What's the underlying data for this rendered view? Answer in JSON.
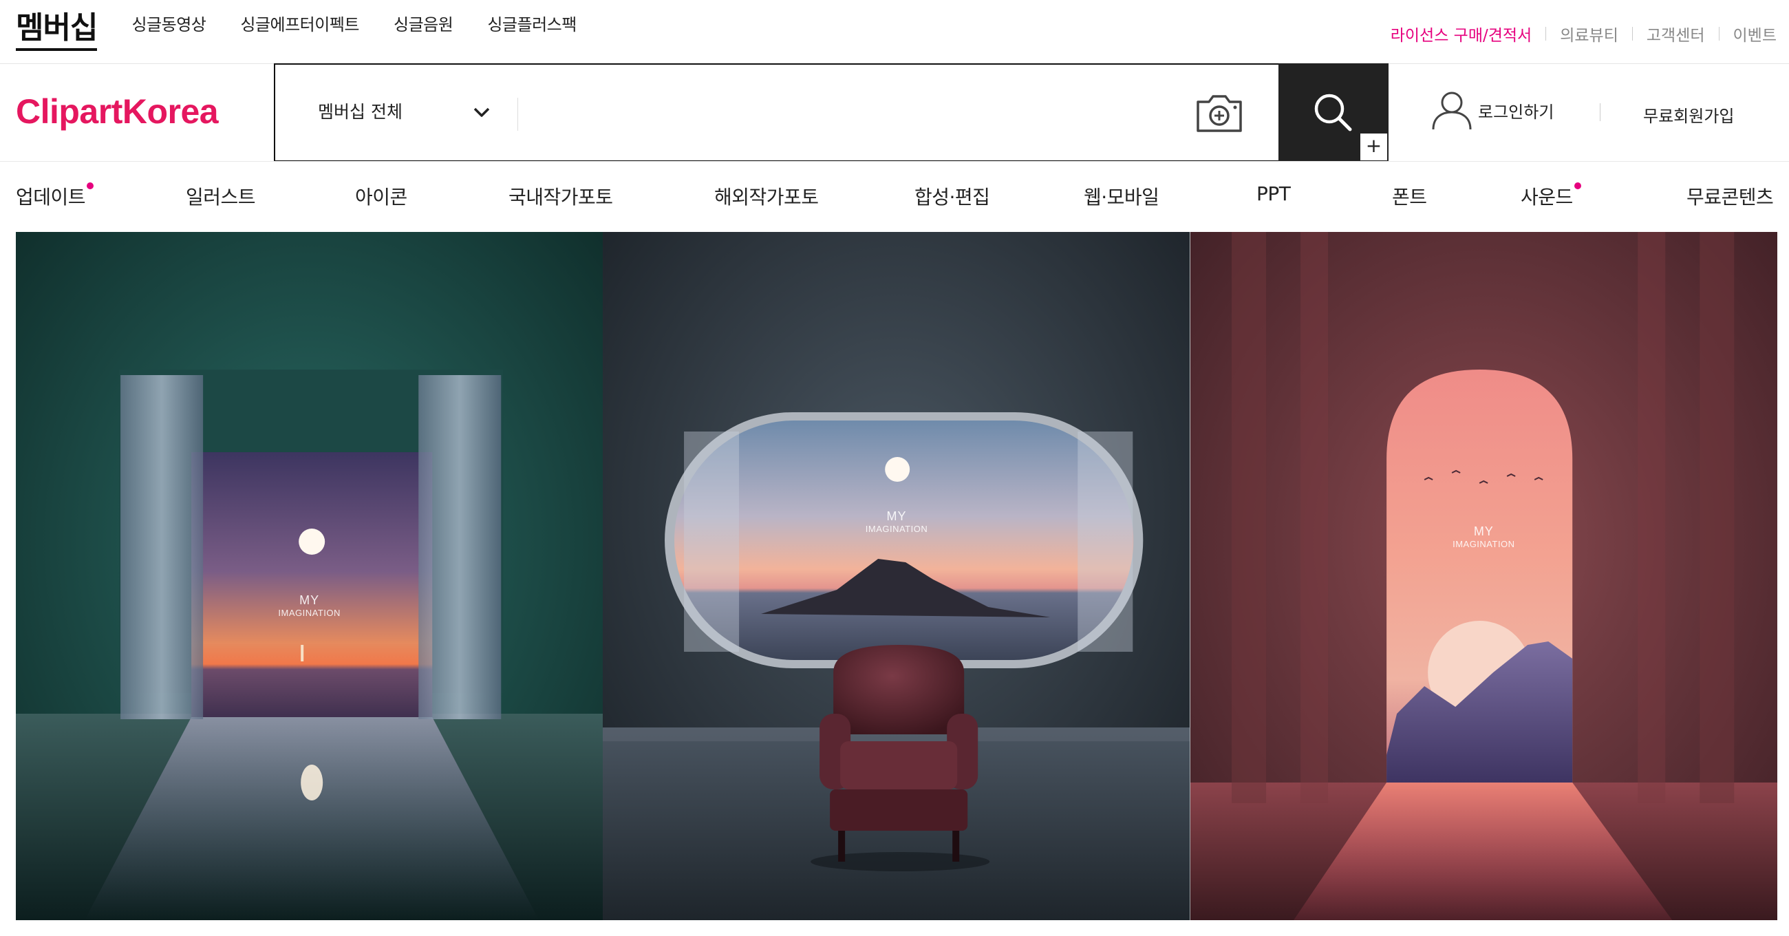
{
  "top_tabs": {
    "main": "멤버십",
    "items": [
      "싱글동영상",
      "싱글에프터이펙트",
      "싱글음원",
      "싱글플러스팩"
    ]
  },
  "util_links": {
    "license": "라이선스 구매/견적서",
    "medical": "의료뷰티",
    "support": "고객센터",
    "event": "이벤트"
  },
  "logo": "ClipartKorea",
  "search": {
    "category": "멤버십 전체",
    "placeholder": "",
    "plus_label": "+"
  },
  "header": {
    "login": "로그인하기",
    "signup": "무료회원가입"
  },
  "categories": [
    {
      "label": "업데이트",
      "new": true
    },
    {
      "label": "일러스트",
      "new": false
    },
    {
      "label": "아이콘",
      "new": false
    },
    {
      "label": "국내작가포토",
      "new": false
    },
    {
      "label": "해외작가포토",
      "new": false
    },
    {
      "label": "합성·편집",
      "new": false
    },
    {
      "label": "웹·모바일",
      "new": false
    },
    {
      "label": "PPT",
      "new": false
    },
    {
      "label": "폰트",
      "new": false
    },
    {
      "label": "사운드",
      "new": true
    },
    {
      "label": "무료콘텐츠",
      "new": false
    }
  ],
  "banner": {
    "panels": [
      {
        "caption": "MY",
        "caption_sub": "IMAGINATION"
      },
      {
        "caption": "MY",
        "caption_sub": "IMAGINATION"
      },
      {
        "caption": "MY",
        "caption_sub": "IMAGINATION"
      }
    ]
  },
  "colors": {
    "accent": "#e6007e",
    "logo": "#e5175f",
    "search_button": "#222222"
  }
}
